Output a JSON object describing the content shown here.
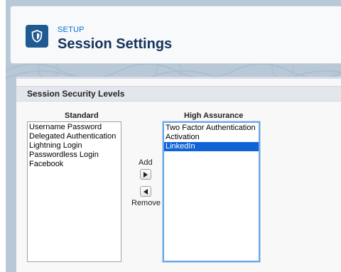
{
  "header": {
    "breadcrumb": "SETUP",
    "title": "Session Settings"
  },
  "section": {
    "title": "Session Security Levels"
  },
  "standard": {
    "heading": "Standard",
    "options": [
      "Username Password",
      "Delegated Authentication",
      "Lightning Login",
      "Passwordless Login",
      "Facebook"
    ]
  },
  "high_assurance": {
    "heading": "High Assurance",
    "options": [
      "Two Factor Authentication",
      "Activation",
      "LinkedIn"
    ],
    "selected": "LinkedIn"
  },
  "controls": {
    "add_label": "Add",
    "remove_label": "Remove"
  },
  "icons": {
    "header_icon": "shield-icon",
    "add_icon": "arrow-right-icon",
    "remove_icon": "arrow-left-icon"
  },
  "colors": {
    "brand_blue": "#1f5a91",
    "breadcrumb_blue": "#0070d2",
    "selection": "#0f63d6",
    "title_text": "#16325c"
  }
}
